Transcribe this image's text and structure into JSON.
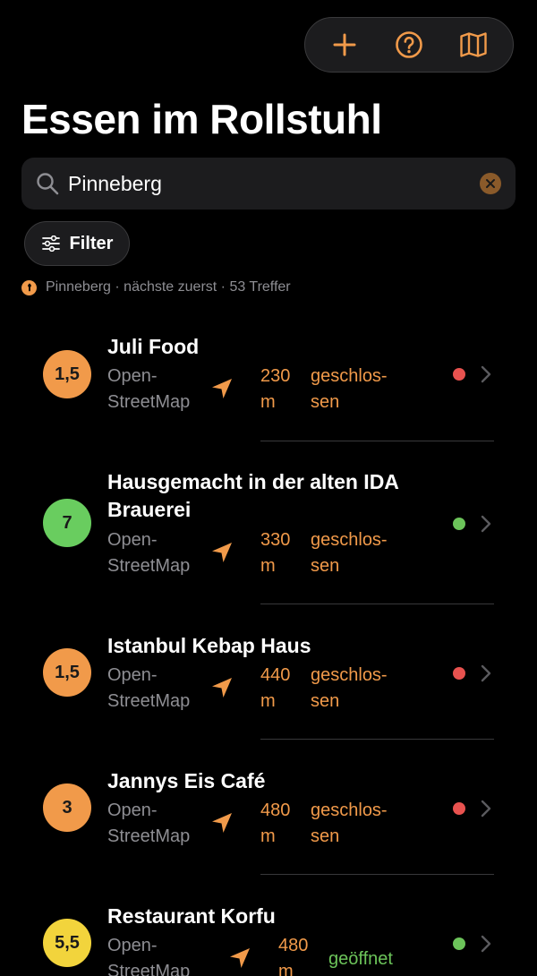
{
  "toolbar": {
    "buttons": [
      {
        "icon": "plus-icon"
      },
      {
        "icon": "help-icon"
      },
      {
        "icon": "map-icon"
      }
    ]
  },
  "page_title": "Essen im Rollstuhl",
  "search": {
    "value": "Pinneberg",
    "placeholder": ""
  },
  "filter": {
    "label": "Filter"
  },
  "status_line": "Pinneberg · nächste zuerst · 53 Treffer",
  "colors": {
    "accent": "#f19a4a",
    "open_green": "#6cc45a",
    "closed_red": "#e8524f",
    "badge_orange": "#f19a4a",
    "badge_green": "#69cd5f",
    "badge_yellow": "#f2d43c"
  },
  "places": [
    {
      "score": "1,5",
      "name": "Juli Food",
      "source_line1": "Open-",
      "source_line2": "StreetMap",
      "distance_line1": "230",
      "distance_line2": "m",
      "state_line1": "geschlos-",
      "state_line2": "sen",
      "open": false
    },
    {
      "score": "7",
      "name": "Hausgemacht in der alten IDA Brauerei",
      "source_line1": "Open-",
      "source_line2": "StreetMap",
      "distance_line1": "330",
      "distance_line2": "m",
      "state_line1": "geschlos-",
      "state_line2": "sen",
      "open": true
    },
    {
      "score": "1,5",
      "name": "Istanbul Kebap Haus",
      "source_line1": "Open-",
      "source_line2": "StreetMap",
      "distance_line1": "440",
      "distance_line2": "m",
      "state_line1": "geschlos-",
      "state_line2": "sen",
      "open": false
    },
    {
      "score": "3",
      "name": "Jannys Eis Café",
      "source_line1": "Open-",
      "source_line2": "StreetMap",
      "distance_line1": "480",
      "distance_line2": "m",
      "state_line1": "geschlos-",
      "state_line2": "sen",
      "open": false
    },
    {
      "score": "5,5",
      "name": "Restaurant Korfu",
      "source_line1": "Open-",
      "source_line2": "StreetMap",
      "distance_line1": "480",
      "distance_line2": "m",
      "state_line1": "geöffnet",
      "state_line2": "",
      "open": true
    }
  ]
}
